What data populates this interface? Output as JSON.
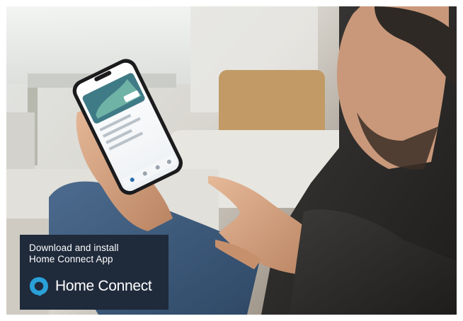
{
  "promo": {
    "line1": "Download and install",
    "line2": "Home Connect App",
    "brand_name": "Home Connect",
    "brand_icon": "home-connect-logo-icon"
  },
  "colors": {
    "promo_background": "#1f2a3b",
    "brand_icon": "#2aa0d8",
    "text": "#ffffff"
  }
}
